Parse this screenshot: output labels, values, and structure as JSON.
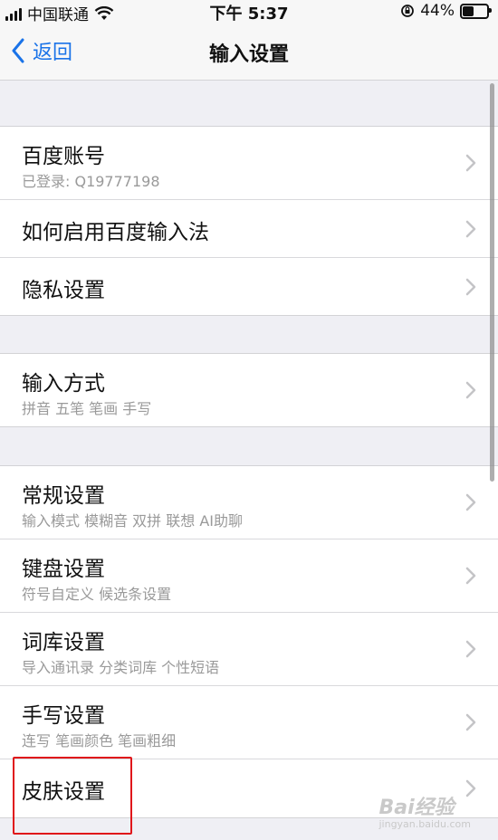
{
  "status_bar": {
    "carrier": "中国联通",
    "time": "下午 5:37",
    "battery_percent": "44%",
    "battery_level": 0.44
  },
  "nav": {
    "back_label": "返回",
    "title": "输入设置"
  },
  "groups": [
    {
      "items": [
        {
          "title": "百度账号",
          "subtitle": "已登录: Q19777198"
        },
        {
          "title": "如何启用百度输入法"
        },
        {
          "title": "隐私设置"
        }
      ]
    },
    {
      "items": [
        {
          "title": "输入方式",
          "subtitle": "拼音 五笔 笔画 手写"
        }
      ]
    },
    {
      "items": [
        {
          "title": "常规设置",
          "subtitle": "输入模式 模糊音 双拼 联想 AI助聊"
        },
        {
          "title": "键盘设置",
          "subtitle": "符号自定义 候选条设置"
        },
        {
          "title": "词库设置",
          "subtitle": "导入通讯录 分类词库 个性短语"
        },
        {
          "title": "手写设置",
          "subtitle": "连写 笔画颜色 笔画粗细"
        },
        {
          "title": "皮肤设置"
        }
      ]
    }
  ],
  "watermark": {
    "brand": "Bai经验",
    "url": "jingyan.baidu.com"
  },
  "colors": {
    "accent": "#1a73e8",
    "highlight": "#e0161a",
    "background": "#efeff4"
  }
}
